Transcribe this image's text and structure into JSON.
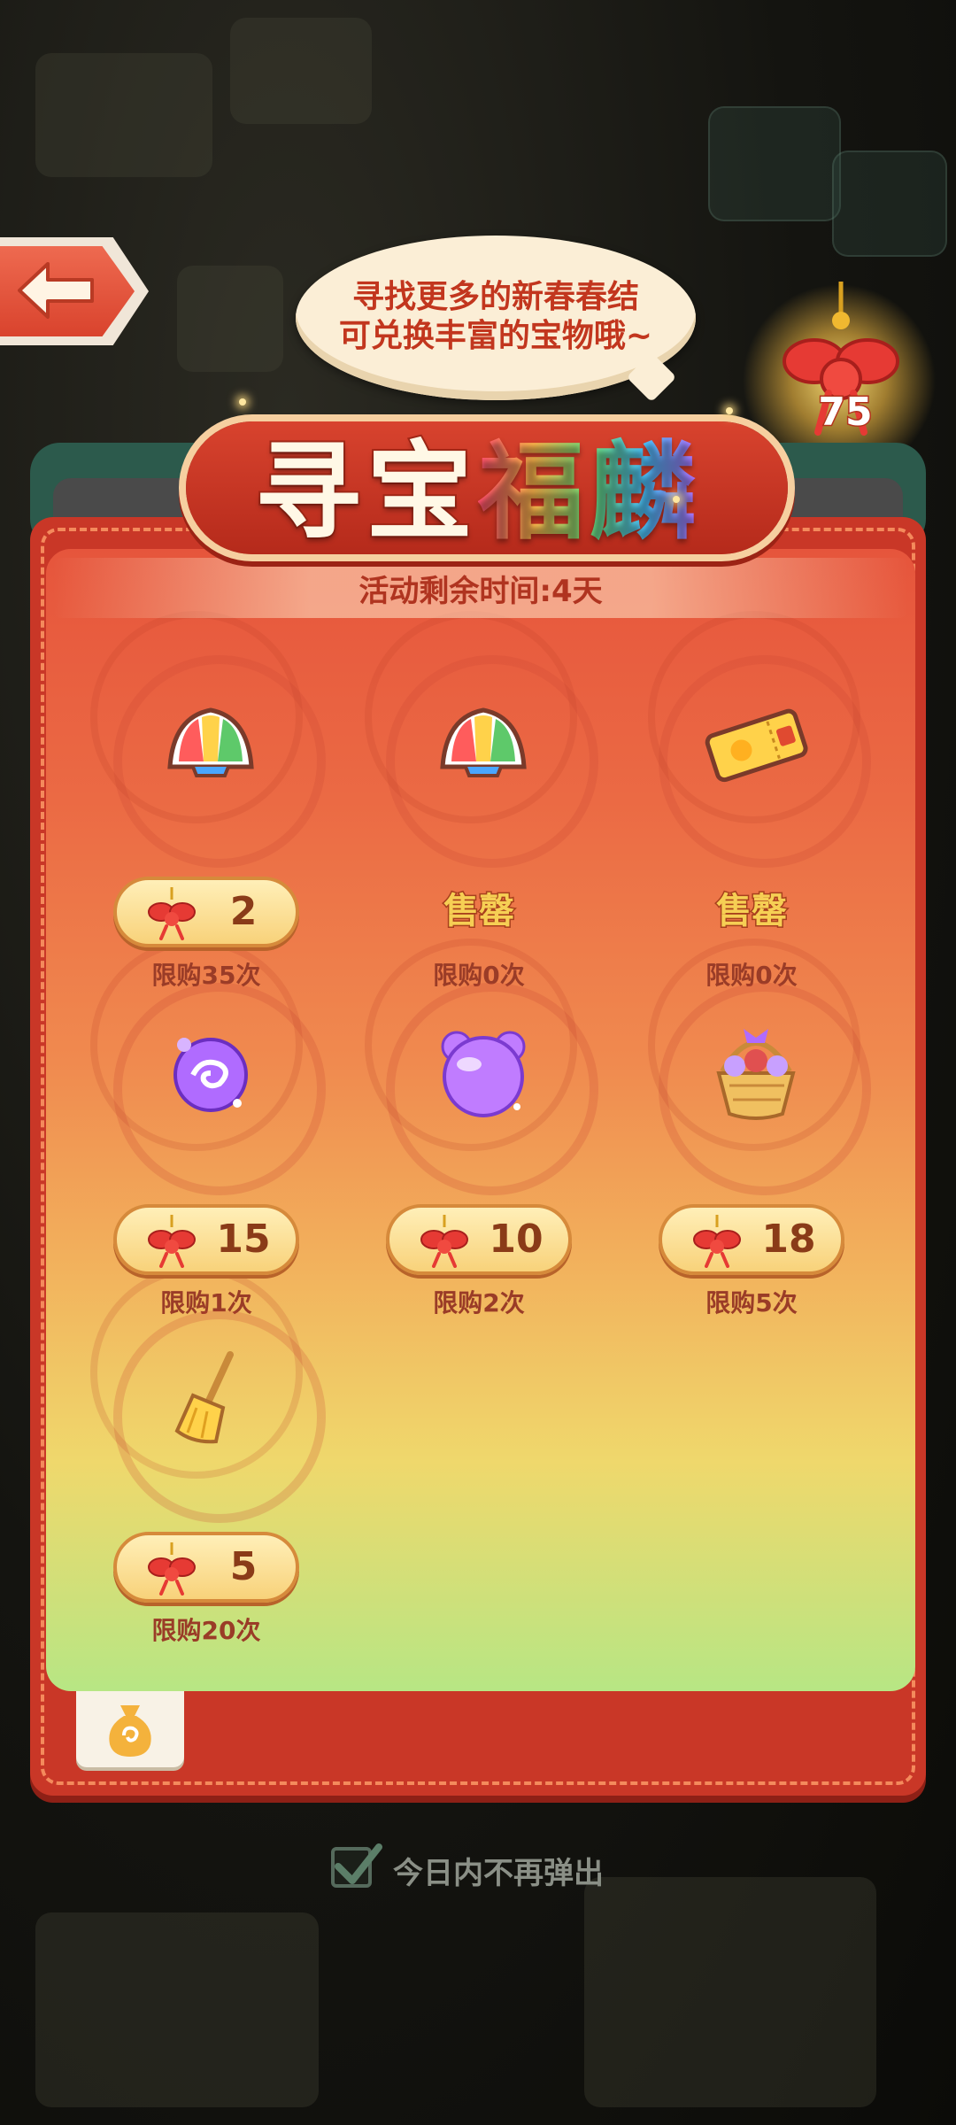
{
  "speech_bubble": {
    "line1": "寻找更多的新春春结",
    "line2": "可兑换丰富的宝物哦~"
  },
  "currency": {
    "icon": "red-knot-icon",
    "count": "75"
  },
  "title": {
    "part1": "寻宝",
    "part2": "福麟"
  },
  "timer": {
    "text": "活动剩余时间:4天"
  },
  "colors": {
    "panel": "#c93727",
    "price_text": "#8a3b18",
    "accent": "#f6cf54"
  },
  "items": [
    {
      "icon": "rainbow-shell-icon",
      "price": "2",
      "sold_out": false,
      "limit": "限购35次"
    },
    {
      "icon": "rainbow-shell-icon",
      "price": "",
      "sold_out": true,
      "sold_out_label": "售罄",
      "limit": "限购0次"
    },
    {
      "icon": "golden-ticket-icon",
      "price": "",
      "sold_out": true,
      "sold_out_label": "售罄",
      "limit": "限购0次"
    },
    {
      "icon": "purple-orb-icon",
      "price": "15",
      "sold_out": false,
      "limit": "限购1次"
    },
    {
      "icon": "purple-bear-jelly-icon",
      "price": "10",
      "sold_out": false,
      "limit": "限购2次"
    },
    {
      "icon": "flower-basket-icon",
      "price": "18",
      "sold_out": false,
      "limit": "限购5次"
    },
    {
      "icon": "broom-icon",
      "price": "5",
      "sold_out": false,
      "limit": "限购20次"
    }
  ],
  "bottom_tab": {
    "icon": "money-bag-icon"
  },
  "footer": {
    "checkbox_checked": true,
    "checkbox_label": "今日内不再弹出"
  }
}
